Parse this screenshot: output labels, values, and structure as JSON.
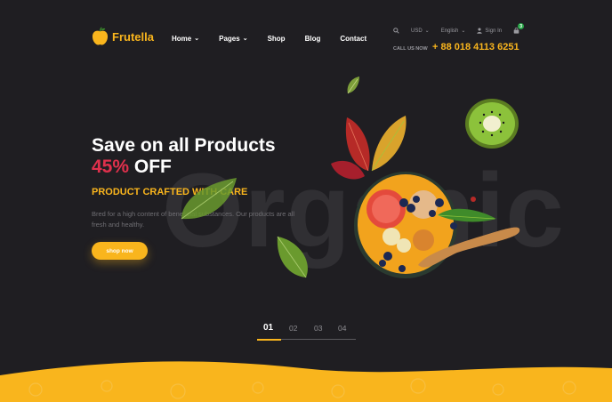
{
  "brand": {
    "name": "Frutella"
  },
  "nav": {
    "items": [
      {
        "label": "Home",
        "has_dropdown": true
      },
      {
        "label": "Pages",
        "has_dropdown": true
      },
      {
        "label": "Shop",
        "has_dropdown": false
      },
      {
        "label": "Blog",
        "has_dropdown": false
      },
      {
        "label": "Contact",
        "has_dropdown": false
      }
    ]
  },
  "utility": {
    "search_icon": "search-icon",
    "currency": "USD",
    "language": "English",
    "sign_in": "Sign In",
    "cart_count": "3"
  },
  "contact": {
    "call_label": "CALL US NOW",
    "phone": "+ 88 018 4113 6251"
  },
  "hero": {
    "headline_line1": "Save on all Products",
    "discount": "45%",
    "discount_suffix": "OFF",
    "tagline": "PRODUCT CRAFTED WITH CARE",
    "description": "Bred for a high content of beneficial substances. Our products are all fresh and healthy.",
    "cta_label": "shop now",
    "background_word": "Organic"
  },
  "slider": {
    "pages": [
      "01",
      "02",
      "03",
      "04"
    ],
    "active_index": 0
  },
  "colors": {
    "background": "#1f1e22",
    "accent": "#f9b51d",
    "discount_red": "#e0304c",
    "badge_green": "#2aa84a"
  }
}
